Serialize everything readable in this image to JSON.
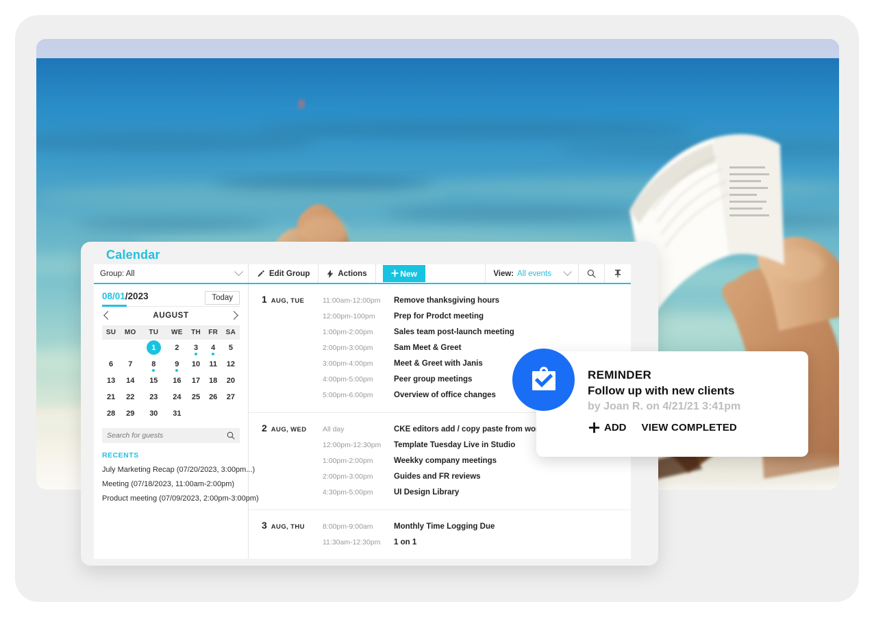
{
  "window": {
    "title": "Calendar"
  },
  "toolbar": {
    "group_label": "Group: All",
    "edit_group_label": "Edit Group",
    "actions_label": "Actions",
    "new_label": "New",
    "view_key": "View:",
    "view_value": "All events",
    "search_icon": "search-icon",
    "pin_icon": "pin-icon",
    "pencil_icon": "pencil-icon",
    "bolt_icon": "bolt-icon",
    "plus_icon": "plus-icon",
    "chevron_down_icon": "chevron-down-icon"
  },
  "sidebar": {
    "date_month_day": "08/01",
    "date_year": "/2023",
    "today_label": "Today",
    "month_label": "AUGUST",
    "prev_icon": "chevron-left-icon",
    "next_icon": "chevron-right-icon",
    "weekdays": [
      "SU",
      "MO",
      "TU",
      "WE",
      "TH",
      "FR",
      "SA"
    ],
    "weeks": [
      [
        {
          "d": "",
          "sel": false,
          "dot": false
        },
        {
          "d": "",
          "sel": false,
          "dot": false
        },
        {
          "d": "1",
          "sel": true,
          "dot": false
        },
        {
          "d": "2",
          "sel": false,
          "dot": false
        },
        {
          "d": "3",
          "sel": false,
          "dot": true
        },
        {
          "d": "4",
          "sel": false,
          "dot": true
        },
        {
          "d": "5",
          "sel": false,
          "dot": false
        }
      ],
      [
        {
          "d": "6",
          "sel": false,
          "dot": false
        },
        {
          "d": "7",
          "sel": false,
          "dot": false
        },
        {
          "d": "8",
          "sel": false,
          "dot": true
        },
        {
          "d": "9",
          "sel": false,
          "dot": true
        },
        {
          "d": "10",
          "sel": false,
          "dot": false
        },
        {
          "d": "11",
          "sel": false,
          "dot": false
        },
        {
          "d": "12",
          "sel": false,
          "dot": false
        }
      ],
      [
        {
          "d": "13",
          "sel": false,
          "dot": false
        },
        {
          "d": "14",
          "sel": false,
          "dot": false
        },
        {
          "d": "15",
          "sel": false,
          "dot": false
        },
        {
          "d": "16",
          "sel": false,
          "dot": false
        },
        {
          "d": "17",
          "sel": false,
          "dot": false
        },
        {
          "d": "18",
          "sel": false,
          "dot": false
        },
        {
          "d": "20",
          "sel": false,
          "dot": false
        }
      ],
      [
        {
          "d": "21",
          "sel": false,
          "dot": false
        },
        {
          "d": "22",
          "sel": false,
          "dot": false
        },
        {
          "d": "23",
          "sel": false,
          "dot": false
        },
        {
          "d": "24",
          "sel": false,
          "dot": false
        },
        {
          "d": "25",
          "sel": false,
          "dot": false
        },
        {
          "d": "26",
          "sel": false,
          "dot": false
        },
        {
          "d": "27",
          "sel": false,
          "dot": false
        }
      ],
      [
        {
          "d": "28",
          "sel": false,
          "dot": false
        },
        {
          "d": "29",
          "sel": false,
          "dot": false
        },
        {
          "d": "30",
          "sel": false,
          "dot": false
        },
        {
          "d": "31",
          "sel": false,
          "dot": false
        },
        {
          "d": "",
          "sel": false,
          "dot": false
        },
        {
          "d": "",
          "sel": false,
          "dot": false
        },
        {
          "d": "",
          "sel": false,
          "dot": false
        }
      ]
    ],
    "guest_search_placeholder": "Search for guests",
    "guest_search_value": "",
    "guest_search_icon": "search-icon",
    "recents_title": "RECENTS",
    "recents": [
      "July Marketing Recap (07/20/2023, 3:00pm...)",
      "Meeting (07/18/2023, 11:00am-2:00pm)",
      "Product meeting (07/09/2023, 2:00pm-3:00pm)"
    ]
  },
  "events": {
    "days": [
      {
        "day_number": "1",
        "day_of_week": "AUG, TUE",
        "items": [
          {
            "time": "11:00am-12:00pm",
            "name": "Remove thanksgiving hours"
          },
          {
            "time": "12:00pm-100pm",
            "name": "Prep for Prodct meeting"
          },
          {
            "time": "1:00pm-2:00pm",
            "name": "Sales team post-launch meeting"
          },
          {
            "time": "2:00pm-3:00pm",
            "name": "Sam Meet & Greet"
          },
          {
            "time": "3:00pm-4:00pm",
            "name": "Meet & Greet with Janis"
          },
          {
            "time": "4:00pm-5:00pm",
            "name": "Peer group meetings"
          },
          {
            "time": "5:00pm-6:00pm",
            "name": "Overview of office changes"
          }
        ]
      },
      {
        "day_number": "2",
        "day_of_week": "AUG, WED",
        "items": [
          {
            "time": "All day",
            "name": "CKE editors add / copy paste from word"
          },
          {
            "time": "12:00pm-12:30pm",
            "name": "Template Tuesday Live in Studio"
          },
          {
            "time": "1:00pm-2:00pm",
            "name": "Weekky company meetings"
          },
          {
            "time": "2:00pm-3:00pm",
            "name": "Guides and FR reviews"
          },
          {
            "time": "4:30pm-5:00pm",
            "name": "UI Design Library"
          }
        ]
      },
      {
        "day_number": "3",
        "day_of_week": "AUG, THU",
        "items": [
          {
            "time": "8:00pm-9:00am",
            "name": "Monthly Time Logging Due"
          },
          {
            "time": "11:30am-12:30pm",
            "name": "1 on 1"
          }
        ]
      }
    ]
  },
  "reminder": {
    "kicker": "REMINDER",
    "title": "Follow up with new clients",
    "meta": "by Joan R. on 4/21/21 3:41pm",
    "add_label": "ADD",
    "view_completed_label": "VIEW COMPLETED",
    "badge_icon": "clipboard-check-icon",
    "plus_icon": "plus-icon"
  },
  "colors": {
    "accent_cyan": "#22C0DE",
    "accent_cyan_fill": "#17C3E0",
    "reminder_blue": "#1A6EF5",
    "page_bg": "#ffffff",
    "card_bg": "#efefef",
    "text_dark": "#1f1f1f",
    "text_muted": "#9a9a9a"
  }
}
